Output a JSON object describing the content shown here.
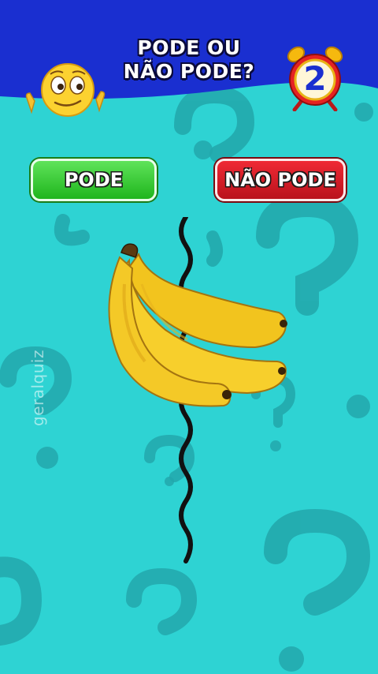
{
  "header": {
    "title_line1": "PODE OU",
    "title_line2": "NÃO PODE?",
    "timer_number": "2"
  },
  "answers": {
    "pode_label": "PODE",
    "nao_pode_label": "NÃO PODE"
  },
  "watermark": "geralquiz",
  "colors": {
    "background": "#2ed3d3",
    "header": "#1a2fd0",
    "pode": "#2cc52a",
    "nao_pode": "#d81b25"
  },
  "icons": {
    "emoji": "thinking-smiley-icon",
    "timer": "alarm-clock-icon",
    "food": "banana-icon",
    "divider": "wavy-line"
  }
}
